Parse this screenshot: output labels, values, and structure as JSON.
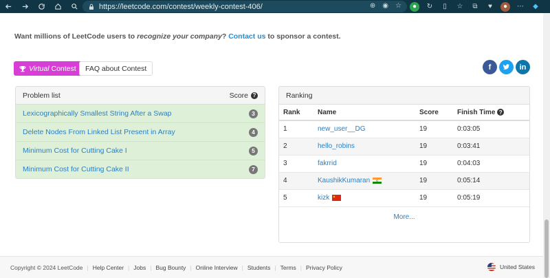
{
  "browser": {
    "url": "https://leetcode.com/contest/weekly-contest-406/"
  },
  "sponsor": {
    "prefix": "Want millions of LeetCode users to ",
    "emphasis": "recognize your company",
    "mid": "? ",
    "link": "Contact us",
    "suffix": " to sponsor a contest."
  },
  "buttons": {
    "virtual_prefix": "Virtual",
    "virtual_suffix": " Contest",
    "faq": "FAQ about Contest"
  },
  "social": {
    "facebook": "f",
    "twitter": "t",
    "linkedin": "in"
  },
  "problems": {
    "header": "Problem list",
    "score_header": "Score",
    "items": [
      {
        "title": "Lexicographically Smallest String After a Swap",
        "score": "3"
      },
      {
        "title": "Delete Nodes From Linked List Present in Array",
        "score": "4"
      },
      {
        "title": "Minimum Cost for Cutting Cake I",
        "score": "5"
      },
      {
        "title": "Minimum Cost for Cutting Cake II",
        "score": "7"
      }
    ]
  },
  "ranking": {
    "header": "Ranking",
    "columns": [
      "Rank",
      "Name",
      "Score",
      "Finish Time"
    ],
    "rows": [
      {
        "rank": "1",
        "name": "new_user__DG",
        "score": "19",
        "time": "0:03:05",
        "flag": ""
      },
      {
        "rank": "2",
        "name": "hello_robins",
        "score": "19",
        "time": "0:03:41",
        "flag": ""
      },
      {
        "rank": "3",
        "name": "fakrrid",
        "score": "19",
        "time": "0:04:03",
        "flag": ""
      },
      {
        "rank": "4",
        "name": "KaushikKumaran",
        "score": "19",
        "time": "0:05:14",
        "flag": "india"
      },
      {
        "rank": "5",
        "name": "kizk",
        "score": "19",
        "time": "0:05:19",
        "flag": "china"
      }
    ],
    "more": "More..."
  },
  "footer": {
    "copyright": "Copyright © 2024 LeetCode",
    "links": [
      "Help Center",
      "Jobs",
      "Bug Bounty",
      "Online Interview",
      "Students",
      "Terms",
      "Privacy Policy"
    ],
    "locale": "United States"
  },
  "colors": {
    "virtual_button": "#d63ed6",
    "link": "#2a7fc4",
    "solved_row": "#dff0d8",
    "chrome": "#103545"
  }
}
